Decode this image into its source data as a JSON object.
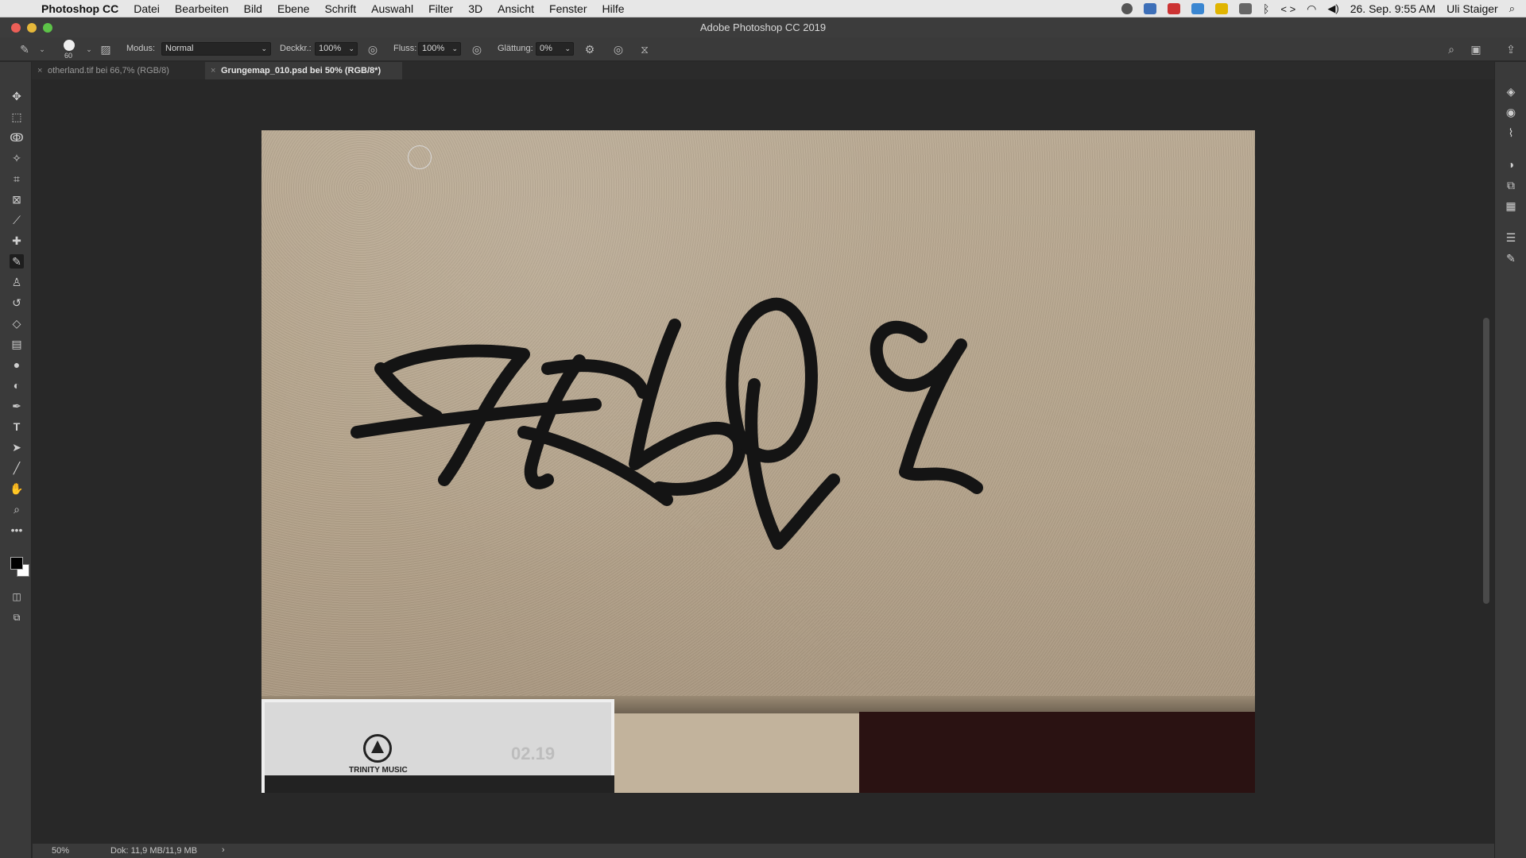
{
  "menubar": {
    "app": "Photoshop CC",
    "items": [
      "Datei",
      "Bearbeiten",
      "Bild",
      "Ebene",
      "Schrift",
      "Auswahl",
      "Filter",
      "3D",
      "Ansicht",
      "Fenster",
      "Hilfe"
    ],
    "datetime": "26. Sep.  9:55 AM",
    "user": "Uli Staiger"
  },
  "window": {
    "title": "Adobe Photoshop CC 2019"
  },
  "options": {
    "brush_size": "60",
    "mode_label": "Modus:",
    "mode_value": "Normal",
    "opacity_label": "Deckkr.:",
    "opacity_value": "100%",
    "flow_label": "Fluss:",
    "flow_value": "100%",
    "smoothing_label": "Glättung:",
    "smoothing_value": "0%"
  },
  "tabs": [
    {
      "label": "otherland.tif bei 66,7% (RGB/8)",
      "active": false
    },
    {
      "label": "Grungemap_010.psd bei 50% (RGB/8*)",
      "active": true
    }
  ],
  "image": {
    "poster_brand": "TRINITY MUSIC",
    "poster_number": "02.19"
  },
  "status": {
    "zoom": "50%",
    "doc": "Dok: 11,9 MB/11,9 MB",
    "arrow": "›"
  },
  "tools": [
    "move-icon",
    "marquee-icon",
    "lasso-icon",
    "magic-wand-icon",
    "crop-icon",
    "frame-icon",
    "eyedropper-icon",
    "healing-icon",
    "brush-icon",
    "stamp-icon",
    "history-brush-icon",
    "eraser-icon",
    "gradient-icon",
    "blur-icon",
    "dodge-icon",
    "pen-icon",
    "type-icon",
    "path-select-icon",
    "line-icon",
    "hand-icon",
    "zoom-icon",
    "more-icon"
  ],
  "colors": {
    "foreground": "#000000",
    "background": "#ffffff"
  }
}
